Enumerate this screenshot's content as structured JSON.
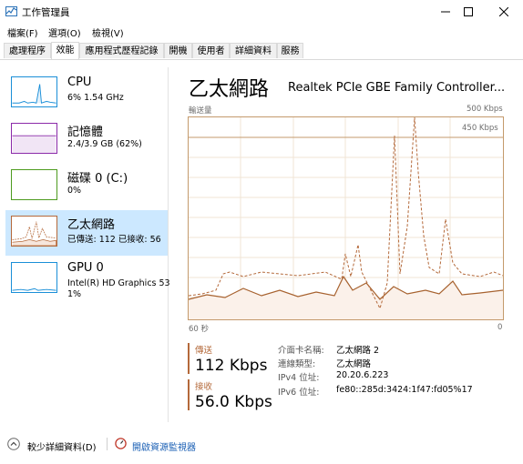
{
  "window": {
    "title": "工作管理員"
  },
  "menu": {
    "file": "檔案(F)",
    "options": "選項(O)",
    "view": "檢視(V)"
  },
  "tabs": [
    "處理程序",
    "效能",
    "應用程式歷程記錄",
    "開機",
    "使用者",
    "詳細資料",
    "服務"
  ],
  "sidebar": {
    "items": [
      {
        "name": "CPU",
        "sub": "6%  1.54 GHz",
        "sub2": ""
      },
      {
        "name": "記憶體",
        "sub": "2.4/3.9 GB (62%)",
        "sub2": ""
      },
      {
        "name": "磁碟 0 (C:)",
        "sub": "0%",
        "sub2": ""
      },
      {
        "name": "乙太網路",
        "sub": "已傳送: 112  已接收: 56",
        "sub2": ""
      },
      {
        "name": "GPU 0",
        "sub": "Intel(R) HD Graphics 53",
        "sub2": "1%"
      }
    ]
  },
  "main": {
    "title": "乙太網路",
    "adapter": "Realtek PCIe GBE Family Controller...",
    "graph_label": "輸送量",
    "max_label": "500 Kbps",
    "line_label": "450 Kbps",
    "time_left": "60 秒",
    "time_right": "0"
  },
  "stats": {
    "send_label": "傳送",
    "send_value": "112 Kbps",
    "recv_label": "接收",
    "recv_value": "56.0 Kbps"
  },
  "props": [
    {
      "label": "介面卡名稱:",
      "value": "乙太網路 2"
    },
    {
      "label": "連線類型:",
      "value": "乙太網路"
    },
    {
      "label": "IPv4 位址:",
      "value": "20.20.6.223"
    },
    {
      "label": "IPv6 位址:",
      "value": "fe80::285d:3424:1f47:fd05%17"
    }
  ],
  "footer": {
    "less_details": "較少詳細資料(D)",
    "open_monitor": "開啟資源監視器"
  },
  "colors": {
    "accent": "#b4693a",
    "selected": "#cce8ff",
    "cpu": "#1a8fd8",
    "memory": "#8b2aa9",
    "disk": "#4d9b1e"
  }
}
